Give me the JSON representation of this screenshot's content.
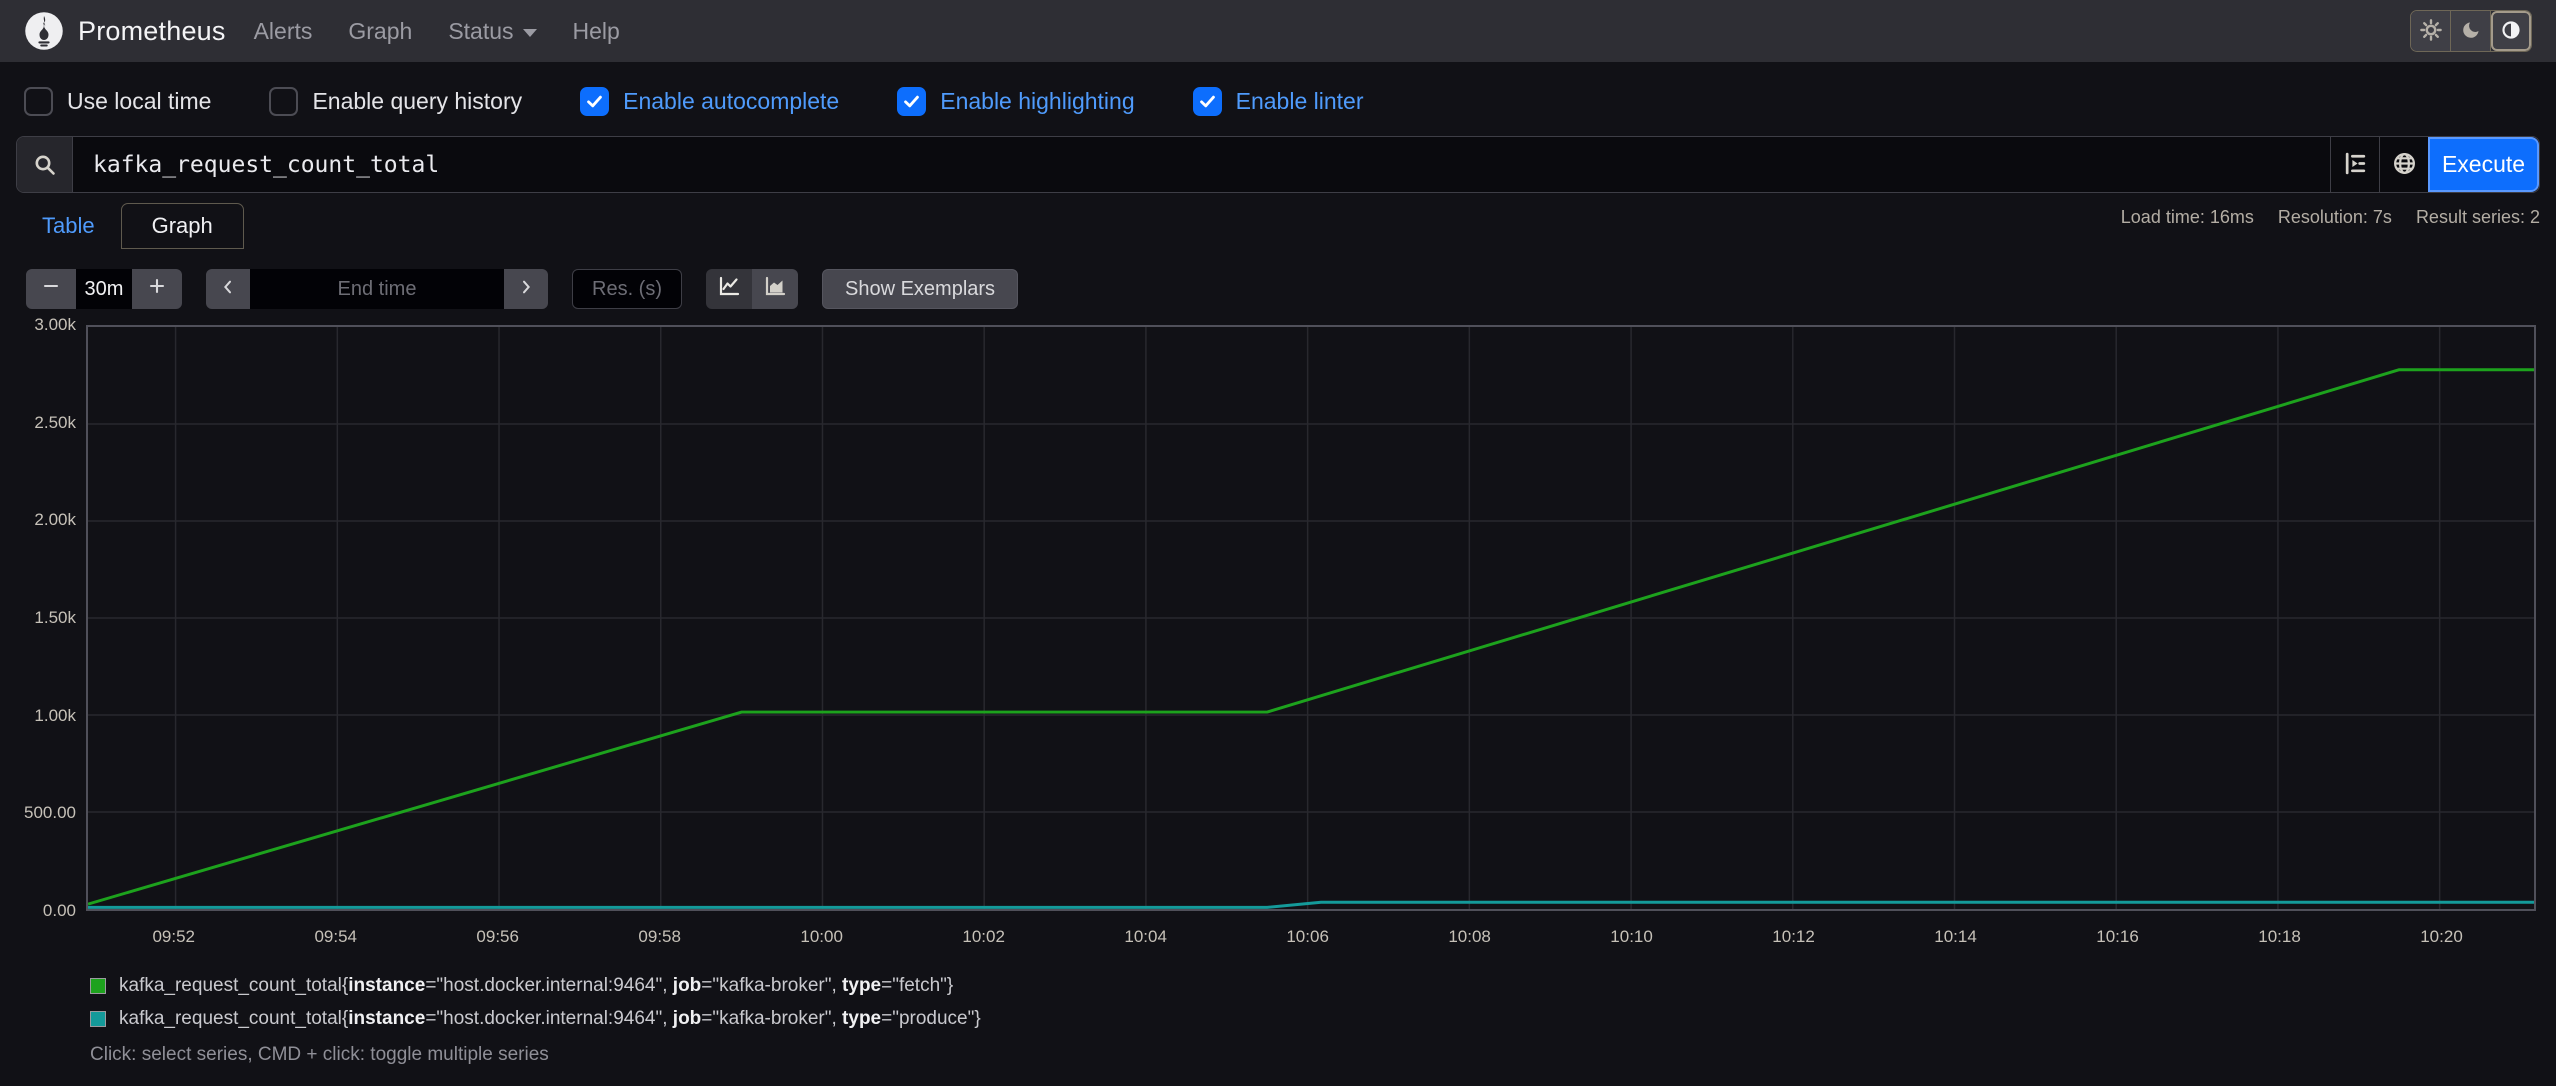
{
  "navbar": {
    "brand": "Prometheus",
    "items": [
      {
        "label": "Alerts"
      },
      {
        "label": "Graph"
      },
      {
        "label": "Status",
        "has_dropdown": true
      },
      {
        "label": "Help"
      }
    ],
    "theme_buttons": [
      {
        "icon": "sun-icon",
        "active": false
      },
      {
        "icon": "moon-icon",
        "active": false
      },
      {
        "icon": "theme-auto-icon",
        "active": true
      }
    ]
  },
  "settings_bar": {
    "options": [
      {
        "label": "Use local time",
        "checked": false
      },
      {
        "label": "Enable query history",
        "checked": false
      },
      {
        "label": "Enable autocomplete",
        "checked": true
      },
      {
        "label": "Enable highlighting",
        "checked": true
      },
      {
        "label": "Enable linter",
        "checked": true
      }
    ]
  },
  "query_bar": {
    "query": "kafka_request_count_total",
    "execute_label": "Execute",
    "icons": [
      "search-icon",
      "metrics-explorer-icon",
      "globe-icon"
    ]
  },
  "stats": {
    "load_time": "Load time: 16ms",
    "resolution": "Resolution: 7s",
    "result_series": "Result series: 2"
  },
  "tabs": {
    "table_label": "Table",
    "graph_label": "Graph",
    "active": "Graph"
  },
  "graph_controls": {
    "range": "30m",
    "end_time_placeholder": "End time",
    "res_placeholder": "Res. (s)",
    "show_exemplars_label": "Show Exemplars"
  },
  "colors": {
    "accent_blue": "#0d6efd",
    "link_blue": "#4f9bfc",
    "series_fetch": "#1da21d",
    "series_produce": "#149a9a",
    "grid": "#28282e",
    "plot_border": "#50505a"
  },
  "chart_data": {
    "type": "line",
    "title": "",
    "xlabel": "time",
    "ylabel": "",
    "grid": true,
    "x_start": "09:50:55",
    "x_end": "10:21:10",
    "x_ticks": [
      "09:52",
      "09:54",
      "09:56",
      "09:58",
      "10:00",
      "10:02",
      "10:04",
      "10:06",
      "10:08",
      "10:10",
      "10:12",
      "10:14",
      "10:16",
      "10:18",
      "10:20"
    ],
    "y_ticks": [
      {
        "label": "0.00",
        "value": 0
      },
      {
        "label": "500.00",
        "value": 500
      },
      {
        "label": "1.00k",
        "value": 1000
      },
      {
        "label": "1.50k",
        "value": 1500
      },
      {
        "label": "2.00k",
        "value": 2000
      },
      {
        "label": "2.50k",
        "value": 2500
      },
      {
        "label": "3.00k",
        "value": 3000
      }
    ],
    "ylim": [
      0,
      3000
    ],
    "series": [
      {
        "name": "kafka_request_count_total{instance=\"host.docker.internal:9464\", job=\"kafka-broker\", type=\"fetch\"}",
        "color": "#1da21d",
        "points": [
          [
            "09:50:55",
            25
          ],
          [
            "09:59:00",
            1015
          ],
          [
            "10:05:30",
            1015
          ],
          [
            "10:19:30",
            2780
          ],
          [
            "10:21:10",
            2780
          ]
        ]
      },
      {
        "name": "kafka_request_count_total{instance=\"host.docker.internal:9464\", job=\"kafka-broker\", type=\"produce\"}",
        "color": "#149a9a",
        "points": [
          [
            "09:50:55",
            8
          ],
          [
            "10:05:30",
            8
          ],
          [
            "10:06:10",
            35
          ],
          [
            "10:21:10",
            35
          ]
        ]
      }
    ]
  },
  "legend": {
    "series": [
      {
        "metric": "kafka_request_count_total",
        "color": "#1da21d",
        "labels": [
          {
            "name": "instance",
            "value": "host.docker.internal:9464"
          },
          {
            "name": "job",
            "value": "kafka-broker"
          },
          {
            "name": "type",
            "value": "fetch"
          }
        ]
      },
      {
        "metric": "kafka_request_count_total",
        "color": "#149a9a",
        "labels": [
          {
            "name": "instance",
            "value": "host.docker.internal:9464"
          },
          {
            "name": "job",
            "value": "kafka-broker"
          },
          {
            "name": "type",
            "value": "produce"
          }
        ]
      }
    ],
    "hint": "Click: select series, CMD + click: toggle multiple series"
  }
}
